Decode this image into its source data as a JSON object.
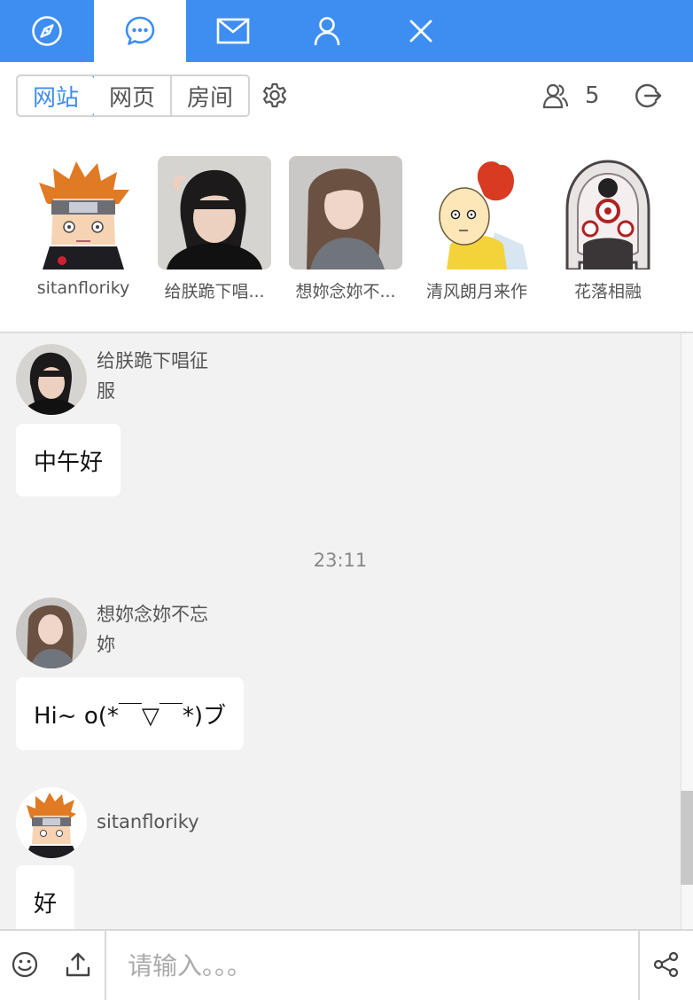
{
  "tabs": [
    {
      "icon": "compass-icon",
      "active": false
    },
    {
      "icon": "chat-bubble-icon",
      "active": true
    },
    {
      "icon": "mail-icon",
      "active": false
    },
    {
      "icon": "user-icon",
      "active": false
    },
    {
      "icon": "close-icon",
      "active": false
    }
  ],
  "toolbar": {
    "segments": [
      "网站",
      "网页",
      "房间"
    ],
    "active_segment": "网站",
    "online_count": "5"
  },
  "online_users": [
    {
      "name": "sitanfloriky",
      "avatar": "pain-avatar"
    },
    {
      "name": "给朕跪下唱...",
      "avatar": "girl-short-hair-avatar"
    },
    {
      "name": "想妳念妳不...",
      "avatar": "girl-long-hair-avatar"
    },
    {
      "name": "清风朗月来作",
      "avatar": "saitama-avatar"
    },
    {
      "name": "花落相融",
      "avatar": "rinnegan-avatar"
    }
  ],
  "messages": [
    {
      "author": "给朕跪下唱征服",
      "text": "中午好"
    },
    {
      "author": "想妳念妳不忘妳",
      "text": "Hi~ o(*￣▽￣*)ブ"
    },
    {
      "author": "sitanfloriky",
      "text": "好"
    }
  ],
  "timestamp": "23:11",
  "input": {
    "placeholder": "请输入。。。",
    "value": ""
  },
  "colors": {
    "accent": "#3d8ef0",
    "chat_bg": "#f2f2f2",
    "bubble": "#ffffff"
  }
}
